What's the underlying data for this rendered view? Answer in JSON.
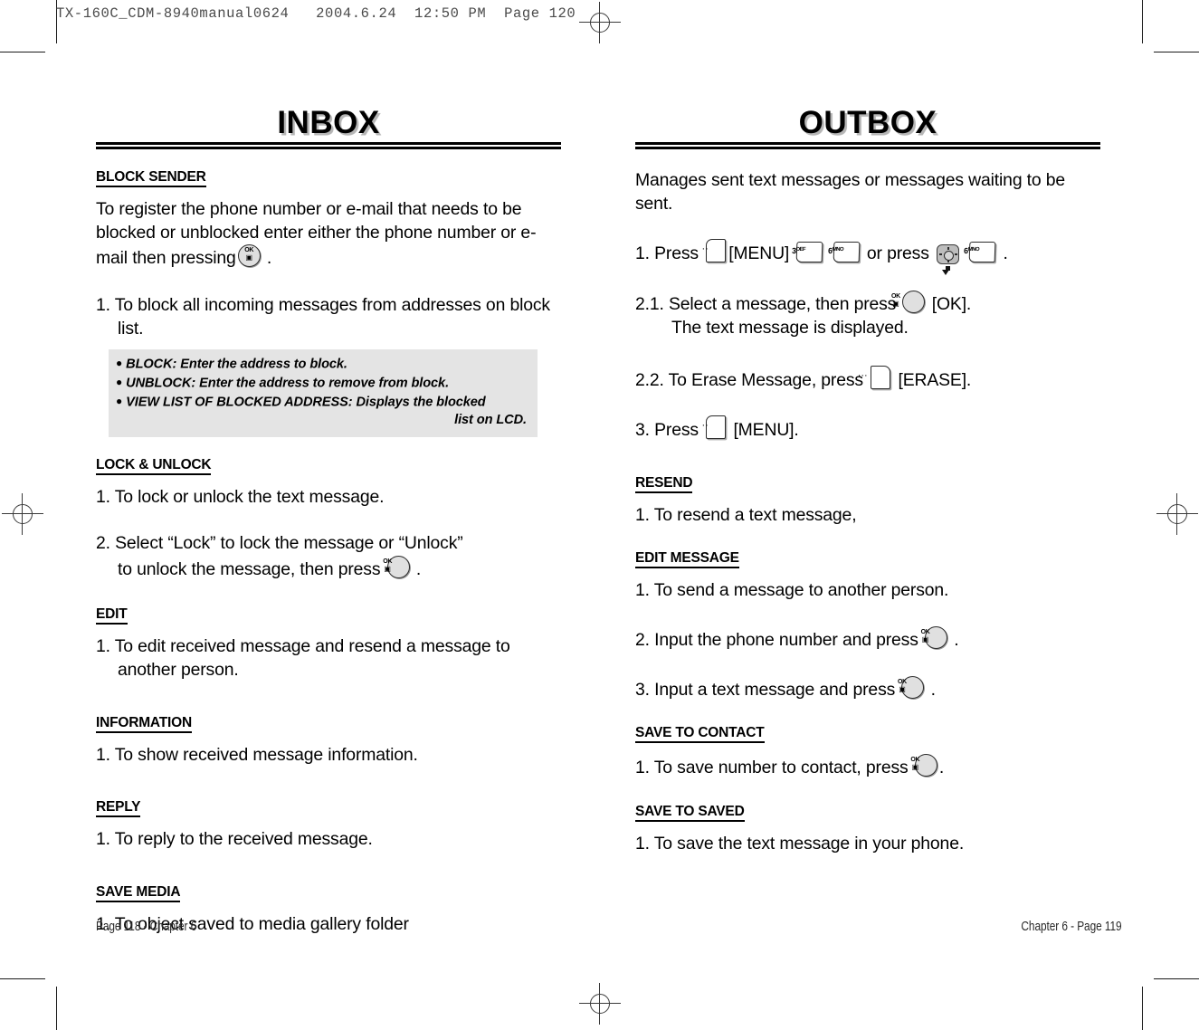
{
  "scan_header": "TX-160C_CDM-8940manual0624   2004.6.24  12:50 PM  Page 120",
  "left_page": {
    "title": "INBOX",
    "sections": [
      {
        "heading": "BLOCK SENDER",
        "paragraphs": [
          "To register the phone number or e-mail that needs to be blocked or unblocked enter either the phone number or e-mail then pressing",
          "1. To block all incoming messages from addresses on block list."
        ],
        "note_box": {
          "lines": [
            "BLOCK: Enter the address to block.",
            "UNBLOCK: Enter the address to remove from block.",
            "VIEW LIST OF BLOCKED ADDRESS: Displays the blocked",
            "list on LCD."
          ]
        }
      },
      {
        "heading": "LOCK & UNLOCK",
        "step1": "1. To lock or unlock the text message.",
        "step2_a": "2. Select “Lock” to lock the message or “Unlock”",
        "step2_b": "to unlock the message, then press",
        "step2_end": "."
      },
      {
        "heading": "EDIT",
        "step1": "1. To edit received message and resend a message to another person."
      },
      {
        "heading": "INFORMATION",
        "step1": "1. To show received message information."
      },
      {
        "heading": "REPLY",
        "step1": "1. To reply to the received message."
      },
      {
        "heading": "SAVE MEDIA",
        "step1": "1. To object saved to media gallery folder"
      }
    ],
    "footer": "Page 118 - Chapter 6"
  },
  "right_page": {
    "title": "OUTBOX",
    "intro": "Manages sent text messages or messages waiting to be sent.",
    "step1_a": "1. Press",
    "step1_b": "[MENU]",
    "step1_c": "or press",
    "step1_end": ".",
    "step21_a": "2.1. Select a message, then press",
    "step21_b": "[OK].",
    "step21_c": "The text message is displayed.",
    "step22_a": "2.2. To Erase Message, press",
    "step22_b": "[ERASE].",
    "step3_a": "3. Press",
    "step3_b": "[MENU].",
    "sections": [
      {
        "heading": "RESEND",
        "step1": "1. To resend a text message,"
      },
      {
        "heading": "EDIT MESSAGE",
        "step1": "1. To send a message to another person.",
        "step2_a": "2. Input the phone number and press",
        "step2_end": ".",
        "step3_a": "3. Input a text message and press",
        "step3_end": "."
      },
      {
        "heading": "SAVE TO CONTACT",
        "step1_a": "1. To save number to contact, press",
        "step1_end": "."
      },
      {
        "heading": "SAVE TO SAVED",
        "step1": "1. To save the text message in your phone."
      }
    ],
    "footer": "Chapter 6 - Page 119"
  },
  "keys": {
    "ok_top": "OK",
    "ok_bottom": "▣",
    "soft_dots_left": "··",
    "soft_dots_right": "···",
    "num3_digit": "3",
    "num3_letters": "DEF",
    "num6_digit": "6",
    "num6_letters": "MNO"
  },
  "colors": {
    "note_box_bg": "#e4e4e4",
    "key_face": "#e0e0e0",
    "nav_pad": "#bdbdbd",
    "title_shadow": "#b6b6b6"
  }
}
